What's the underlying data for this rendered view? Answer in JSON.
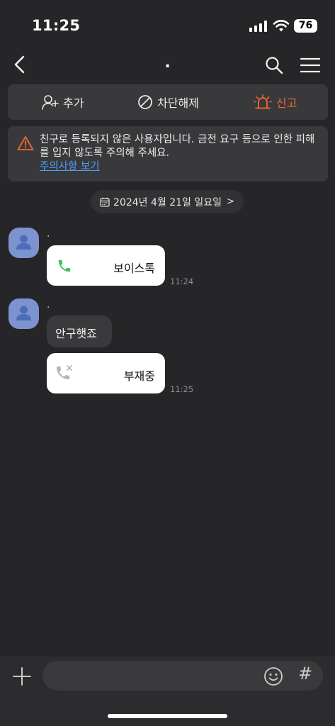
{
  "status": {
    "time": "11:25",
    "battery": "76"
  },
  "nav": {
    "title": "."
  },
  "actions": {
    "add": "추가",
    "unblock": "차단해제",
    "report": "신고"
  },
  "warning": {
    "text": "친구로 등록되지 않은 사용자입니다. 금전 요구 등으로 인한 피해를 입지 않도록 주의해 주세요.",
    "link": "주의사항 보기"
  },
  "date": "2024년 4월 21일 일요일",
  "messages": [
    {
      "sender": ".",
      "call_label": "보이스톡",
      "time": "11:24"
    },
    {
      "sender": ".",
      "text": "안구햇죠",
      "missed_label": "부재중",
      "time": "11:25"
    }
  ],
  "input": {
    "value": ""
  },
  "colors": {
    "accent_report": "#f06a2a",
    "link": "#4d9ef6",
    "call_green": "#3ec45b",
    "avatar": "#7d93cf"
  }
}
